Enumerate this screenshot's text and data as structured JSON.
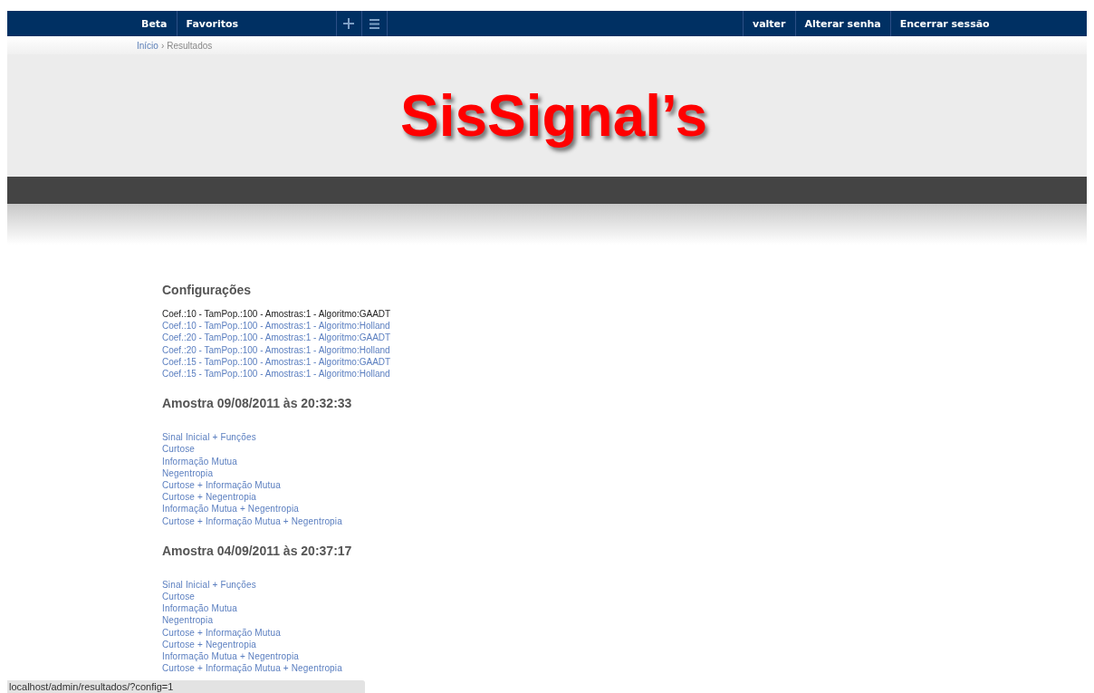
{
  "nav": {
    "left": [
      "Beta",
      "Favoritos"
    ],
    "right": [
      "valter",
      "Alterar senha",
      "Encerrar sessão"
    ]
  },
  "breadcrumb": {
    "home": "Início",
    "separator": "›",
    "current": "Resultados"
  },
  "logo": "SisSignal’s",
  "configurations": {
    "title": "Configurações",
    "items": [
      {
        "label": "Coef.:10 - TamPop.:100 - Amostras:1 - Algoritmo:GAADT",
        "selected": true
      },
      {
        "label": "Coef.:10 - TamPop.:100 - Amostras:1 - Algoritmo:Holland",
        "selected": false
      },
      {
        "label": "Coef.:20 - TamPop.:100 - Amostras:1 - Algoritmo:GAADT",
        "selected": false
      },
      {
        "label": "Coef.:20 - TamPop.:100 - Amostras:1 - Algoritmo:Holland",
        "selected": false
      },
      {
        "label": "Coef.:15 - TamPop.:100 - Amostras:1 - Algoritmo:GAADT",
        "selected": false
      },
      {
        "label": "Coef.:15 - TamPop.:100 - Amostras:1 - Algoritmo:Holland",
        "selected": false
      }
    ]
  },
  "samples": [
    {
      "title": "Amostra 09/08/2011 às 20:32:33",
      "links": [
        "Sinal Inicial + Funções",
        "Curtose",
        "Informação Mutua",
        "Negentropia",
        "Curtose + Informação Mutua",
        "Curtose + Negentropia",
        "Informação Mutua + Negentropia",
        "Curtose + Informação Mutua + Negentropia"
      ]
    },
    {
      "title": "Amostra 04/09/2011 às 20:37:17",
      "links": [
        "Sinal Inicial + Funções",
        "Curtose",
        "Informação Mutua",
        "Negentropia",
        "Curtose + Informação Mutua",
        "Curtose + Negentropia",
        "Informação Mutua + Negentropia",
        "Curtose + Informação Mutua + Negentropia"
      ]
    }
  ],
  "status_bar": "localhost/admin/resultados/?config=1"
}
